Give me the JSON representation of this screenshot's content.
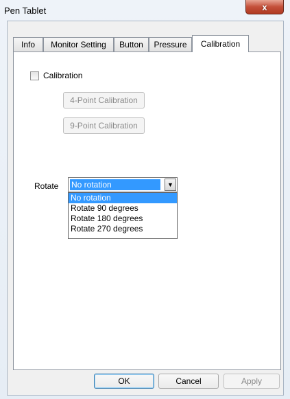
{
  "window": {
    "title": "Pen Tablet",
    "close_label": "x"
  },
  "tabs": [
    {
      "label": "Info"
    },
    {
      "label": "Monitor Setting"
    },
    {
      "label": "Button"
    },
    {
      "label": "Pressure"
    },
    {
      "label": "Calibration",
      "active": true
    }
  ],
  "calibration": {
    "checkbox_label": "Calibration",
    "checked": false,
    "four_point_label": "4-Point Calibration",
    "nine_point_label": "9-Point Calibration"
  },
  "rotate": {
    "label": "Rotate",
    "selected": "No rotation",
    "options": [
      "No rotation",
      "Rotate 90 degrees",
      "Rotate 180 degrees",
      "Rotate 270 degrees"
    ]
  },
  "footer": {
    "ok_label": "OK",
    "cancel_label": "Cancel",
    "apply_label": "Apply"
  }
}
